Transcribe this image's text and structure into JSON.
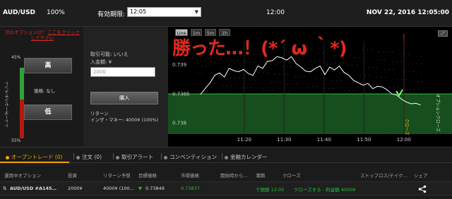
{
  "topbar": {
    "pair": "AUD/USD",
    "payout": "100%",
    "expiry_label": "有効期限:",
    "expiry_value": "12:05",
    "expiry_time": "12:00",
    "datetime": "NOV 22, 2016 12:05:00"
  },
  "left": {
    "instruction_prefix": "次のオプションは？",
    "instruction_link": "ここをクリックして下さい",
    "meter_top_pct": "45%",
    "meter_bottom_pct": "55%",
    "meter_label": "トレーダーセンチメント",
    "meter_high_fraction": 0.45,
    "high_label": "高",
    "low_label": "低",
    "price_label": "価格: なし"
  },
  "mid": {
    "tradable": "取引可能: いいえ",
    "amount_label": "入金額: ¥",
    "amount_placeholder": "2000",
    "buy_label": "購入",
    "return_label": "リターン",
    "in_the_money": "インザ・マネー: 4000¥ (100%)"
  },
  "chart": {
    "timeframes": [
      "Line",
      "1m",
      "5m",
      "1h"
    ],
    "active_timeframe": "Line",
    "overlay": "勝った…！(*´ ω ｀*)",
    "vertical_label_option": "オプションクローズ",
    "vertical_label_close": "クローズ",
    "colors": {
      "up_zone": "#1a5c22",
      "line": "#ffffff",
      "expiry_marker": "#d42020"
    }
  },
  "chart_data": {
    "type": "line",
    "y_ticks": [
      "0.739",
      "0.7385",
      "0.738"
    ],
    "x_ticks": [
      "11:20",
      "11:30",
      "11:40",
      "11:50",
      "12:00"
    ],
    "ylim": [
      0.7378,
      0.7394
    ],
    "xlim": [
      11.133,
      12.083
    ],
    "entry_price": 0.73849,
    "close_price": 0.73837,
    "series": [
      {
        "x": [
          11.15,
          11.17,
          11.19,
          11.21,
          11.23,
          11.25,
          11.27,
          11.29,
          11.31,
          11.33,
          11.35,
          11.37,
          11.39,
          11.41,
          11.43,
          11.45,
          11.47,
          11.49,
          11.51,
          11.53,
          11.55,
          11.57,
          11.59,
          11.61,
          11.63,
          11.65,
          11.67,
          11.69,
          11.71,
          11.73,
          11.75,
          11.77,
          11.79,
          11.81,
          11.83,
          11.85,
          11.87,
          11.89,
          11.91,
          11.93,
          11.95,
          11.97,
          11.99,
          12.01,
          12.03,
          12.05,
          12.07
        ],
        "y": [
          0.73848,
          0.73858,
          0.73868,
          0.73881,
          0.73885,
          0.73878,
          0.73893,
          0.73889,
          0.73887,
          0.73891,
          0.73884,
          0.73881,
          0.73897,
          0.73893,
          0.73905,
          0.73906,
          0.73913,
          0.73911,
          0.73907,
          0.73913,
          0.73901,
          0.73895,
          0.73888,
          0.73887,
          0.73893,
          0.73897,
          0.73882,
          0.73895,
          0.7389,
          0.73897,
          0.73886,
          0.73881,
          0.73872,
          0.73868,
          0.73864,
          0.73867,
          0.73858,
          0.73862,
          0.73861,
          0.73856,
          0.73849,
          0.73847,
          0.7384,
          0.73835,
          0.73832,
          0.73833,
          0.7383
        ]
      }
    ]
  },
  "tabs": [
    {
      "label": "オープントレード (0)"
    },
    {
      "label": "注文 (0)"
    },
    {
      "label": "取引アラート"
    },
    {
      "label": "コンベンティション"
    },
    {
      "label": "金融カレンダー"
    }
  ],
  "table": {
    "headers": [
      "運用中オプション",
      "投資",
      "リターン予想",
      "目標価格",
      "市場価格",
      "開始時から…",
      "満期",
      "クローズ",
      "ストップロス/テイク…",
      "シェア"
    ],
    "row": {
      "option": "AUD/USD #A145…",
      "investment": "2000¥",
      "expected_return": "4000¥ (100…",
      "target_price": "0.73849",
      "market_price": "0.73837",
      "since_open": "",
      "expiry": "で閉鎖 12:05",
      "close": "クローズする - 利益額 4000¥",
      "stoploss": ""
    }
  }
}
